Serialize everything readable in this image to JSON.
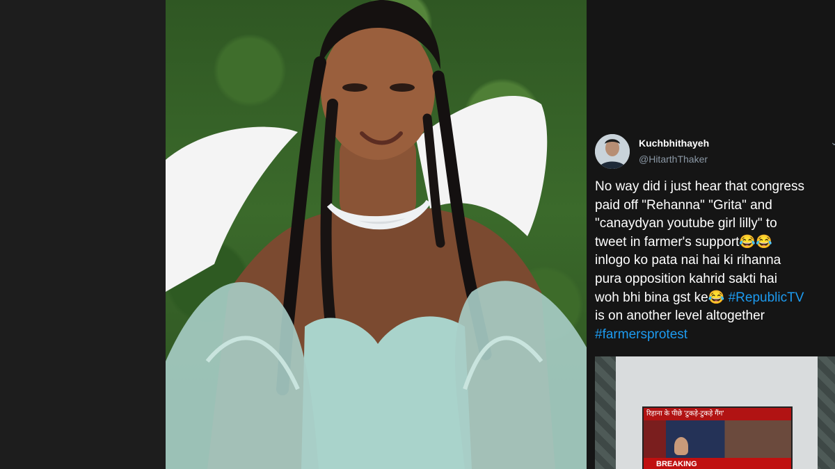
{
  "tweet": {
    "display_name": "Kuchbhithayeh",
    "handle": "@HitarthThaker",
    "lines": [
      "No way did i just hear that congress",
      "paid off \"Rehanna\" \"Grita\" and",
      "\"canaydyan youtube girl lilly\" to",
      "tweet in farmer's support😂😂",
      "inlogo ko pata nai hai ki rihanna",
      "pura opposition kahrid sakti hai"
    ],
    "line7_text": "woh bhi bina gst ke😂 ",
    "line7_hashtag": "#RepublicTV",
    "line8": "is on another level altogether",
    "hashtag_2": "#farmersprotest",
    "hashtag_color": "#1d9bf0"
  },
  "embed_image": {
    "tv_headline": "रिहाना के पीछे 'टुकड़े-टुकड़े गैंग'",
    "tv_ticker": "BREAKING"
  },
  "icons": {
    "chevron": "chevron-down-icon"
  }
}
